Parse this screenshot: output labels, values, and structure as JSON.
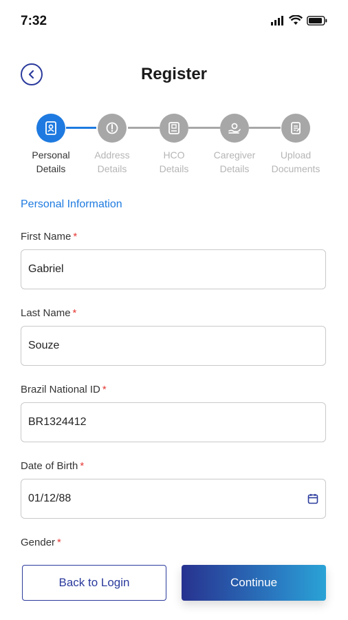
{
  "status": {
    "time": "7:32"
  },
  "header": {
    "title": "Register"
  },
  "stepper": {
    "steps": [
      {
        "line1": "Personal",
        "line2": "Details",
        "icon": "id-card-icon",
        "active": true
      },
      {
        "line1": "Address",
        "line2": "Details",
        "icon": "map-pin-icon",
        "active": false
      },
      {
        "line1": "HCO",
        "line2": "Details",
        "icon": "building-icon",
        "active": false
      },
      {
        "line1": "Caregiver",
        "line2": "Details",
        "icon": "caregiver-icon",
        "active": false
      },
      {
        "line1": "Upload",
        "line2": "Documents",
        "icon": "document-icon",
        "active": false
      }
    ]
  },
  "form": {
    "section_title": "Personal Information",
    "required_mark": "*",
    "fields": {
      "first_name": {
        "label": "First Name",
        "value": "Gabriel"
      },
      "last_name": {
        "label": "Last Name",
        "value": "Souze"
      },
      "national_id": {
        "label": "Brazil National ID",
        "value": "BR1324412"
      },
      "dob": {
        "label": "Date of Birth",
        "value": "01/12/88"
      },
      "gender": {
        "label": "Gender"
      }
    }
  },
  "actions": {
    "back_label": "Back to Login",
    "continue_label": "Continue"
  },
  "colors": {
    "primary": "#1e7ae0",
    "navy": "#2a3a9c",
    "required": "#e53935"
  }
}
